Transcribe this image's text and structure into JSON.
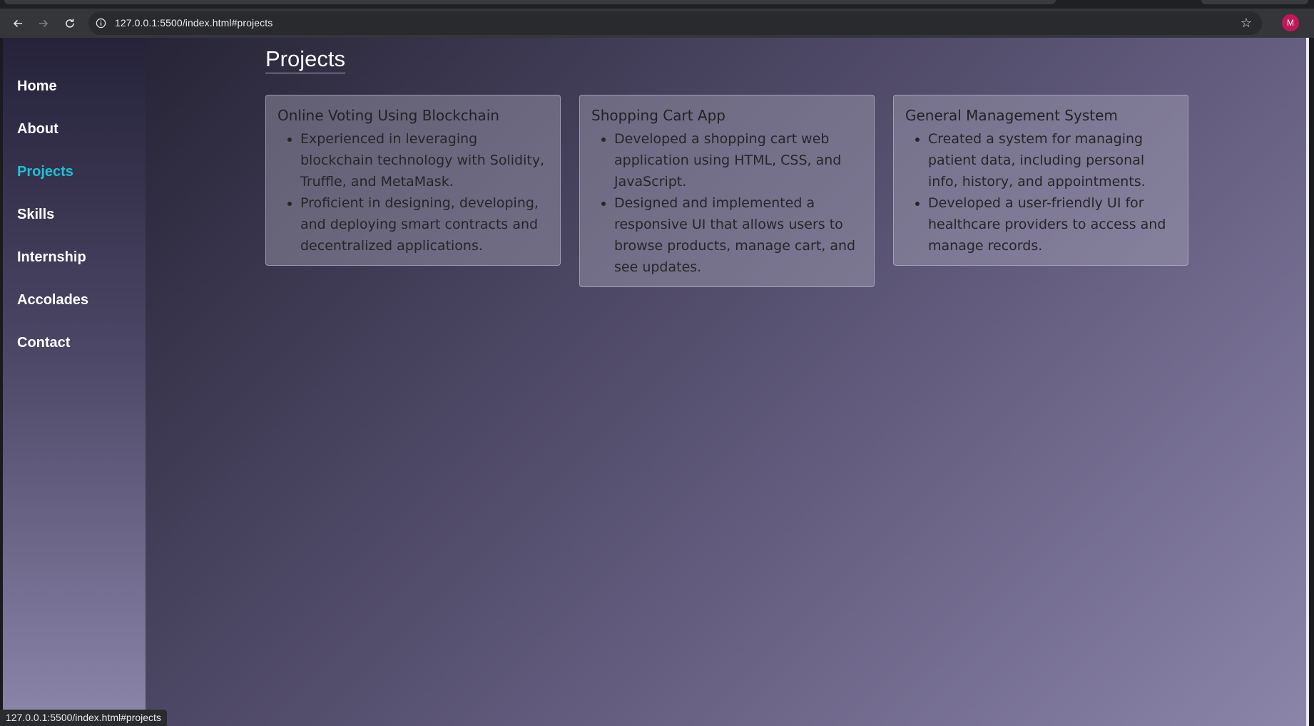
{
  "browser": {
    "url": "127.0.0.1:5500/index.html#projects",
    "profile_initial": "M",
    "status_url": "127.0.0.1:5500/index.html#projects"
  },
  "sidebar": {
    "items": [
      {
        "label": "Home",
        "active": false
      },
      {
        "label": "About",
        "active": false
      },
      {
        "label": "Projects",
        "active": true
      },
      {
        "label": "Skills",
        "active": false
      },
      {
        "label": "Internship",
        "active": false
      },
      {
        "label": "Accolades",
        "active": false
      },
      {
        "label": "Contact",
        "active": false
      }
    ],
    "active_color": "#1ec1d6"
  },
  "main": {
    "section_title": "Projects",
    "projects": [
      {
        "title": "Online Voting Using Blockchain",
        "points": [
          "Experienced in leveraging blockchain technology with Solidity, Truffle, and MetaMask.",
          "Proficient in designing, developing, and deploying smart contracts and decentralized applications."
        ]
      },
      {
        "title": "Shopping Cart App",
        "points": [
          "Developed a shopping cart web application using HTML, CSS, and JavaScript.",
          "Designed and implemented a responsive UI that allows users to browse products, manage cart, and see updates."
        ]
      },
      {
        "title": "General Management System",
        "points": [
          "Created a system for managing patient data, including personal info, history, and appointments.",
          "Developed a user-friendly UI for healthcare providers to access and manage records."
        ]
      }
    ]
  }
}
